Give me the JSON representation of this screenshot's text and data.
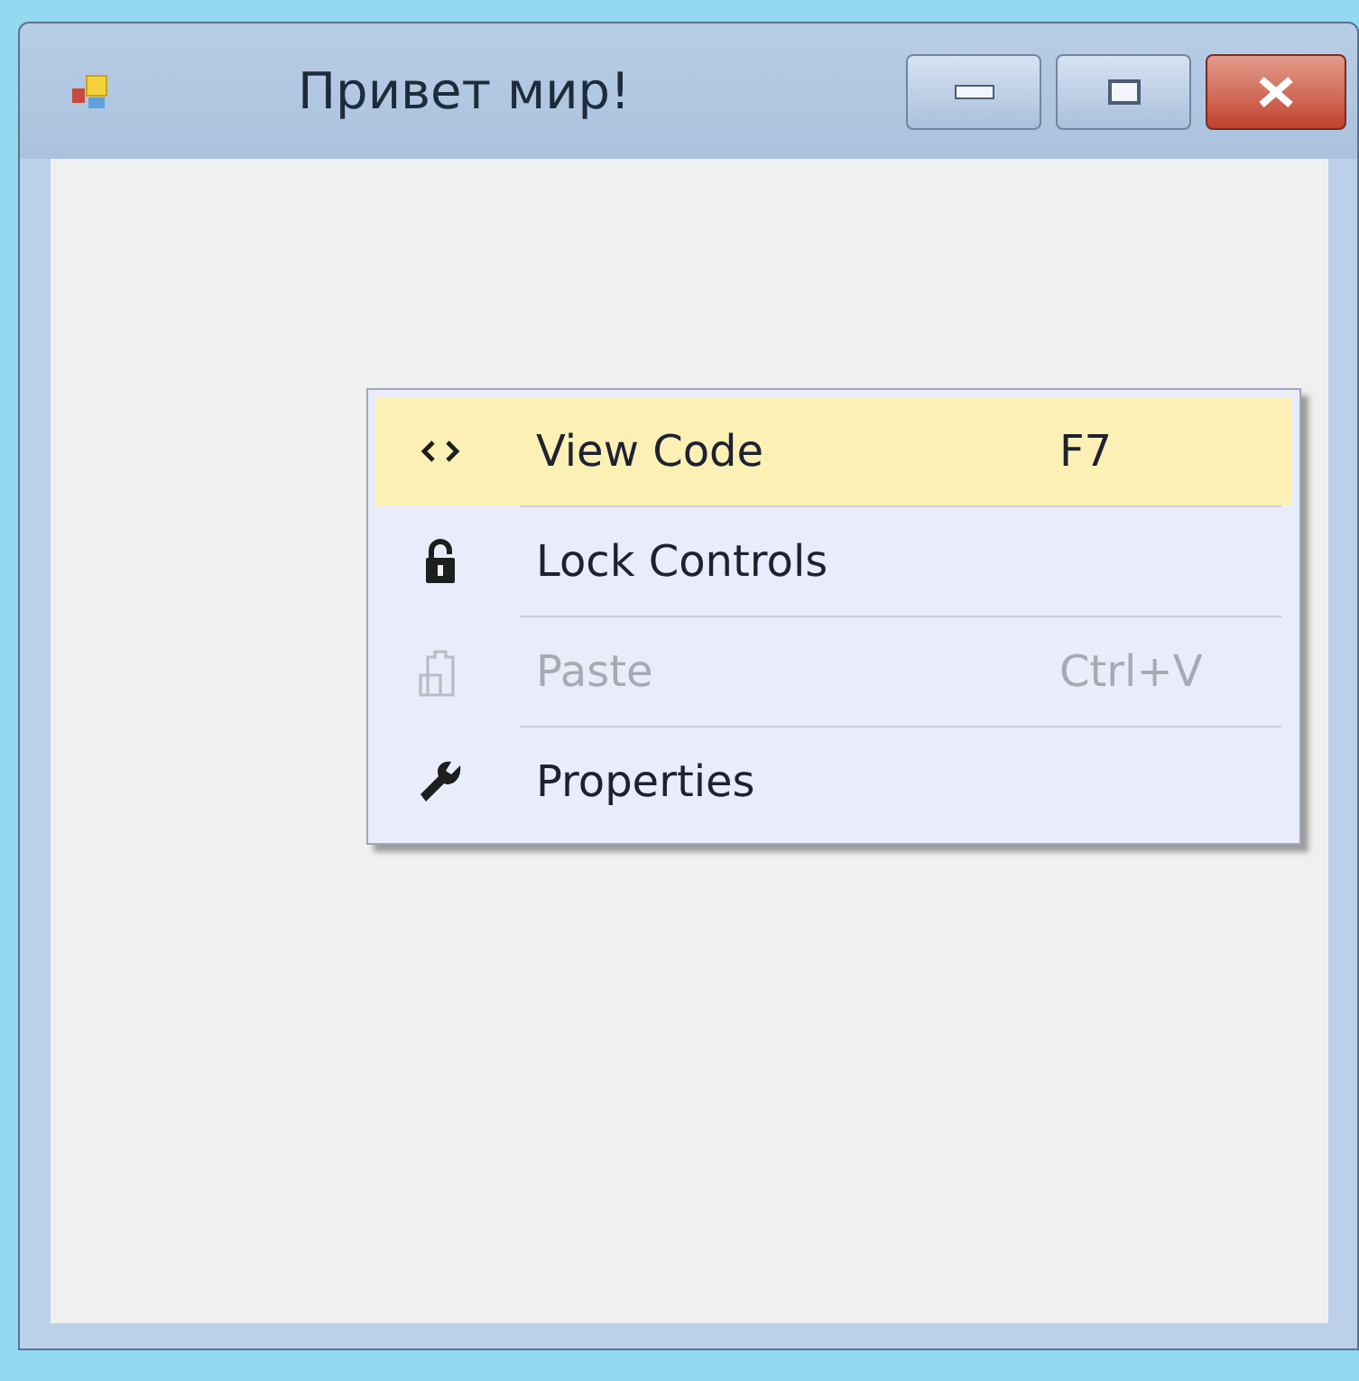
{
  "window": {
    "title": "Привет мир!"
  },
  "context_menu": {
    "items": [
      {
        "kind": "code",
        "label": "View Code",
        "shortcut": "F7",
        "selected": true,
        "disabled": false
      },
      {
        "kind": "lock",
        "label": "Lock Controls",
        "selected": false,
        "disabled": false
      },
      {
        "kind": "paste",
        "label": "Paste",
        "shortcut": "Ctrl+V",
        "selected": false,
        "disabled": true
      },
      {
        "kind": "wrench",
        "label": "Properties",
        "selected": false,
        "disabled": false
      }
    ]
  }
}
